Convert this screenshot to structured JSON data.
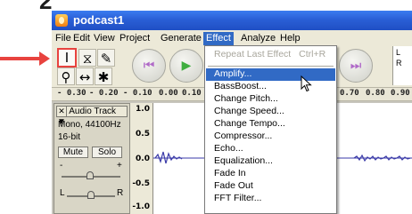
{
  "step_number": "2",
  "window": {
    "title": "podcast1"
  },
  "menubar": {
    "items": [
      "File",
      "Edit",
      "View",
      "Project",
      "Generate",
      "Effect",
      "Analyze",
      "Help"
    ],
    "active": "Effect"
  },
  "tools": {
    "selection_tool": "I",
    "envelope_tool": "⧖",
    "draw_tool": "✎",
    "zoom_tool": "⚲",
    "timeshift_tool": "↔",
    "multi_tool": "✱"
  },
  "transport": {
    "rewind_glyph": "⏮",
    "play_glyph": "▶",
    "forward_glyph": "⏭"
  },
  "meter": {
    "l": "L",
    "r": "R"
  },
  "ruler": {
    "left_ticks": [
      "- 0.30",
      "- 0.20",
      "- 0.10",
      "0.00",
      "0.10"
    ],
    "right_ticks": [
      "0.70",
      "0.80",
      "0.90"
    ]
  },
  "track": {
    "name": "Audio Track",
    "info_rate": "Mono, 44100Hz",
    "info_bits": "16-bit",
    "mute": "Mute",
    "solo": "Solo",
    "gain_minus": "-",
    "gain_plus": "+",
    "pan_left": "L",
    "pan_right": "R",
    "vruler_ticks": [
      "1.0",
      "0.5",
      "0.0",
      "-0.5",
      "-1.0"
    ]
  },
  "effect_menu": {
    "repeat_label": "Repeat Last Effect",
    "repeat_shortcut": "Ctrl+R",
    "items": [
      "Amplify...",
      "BassBoost...",
      "Change Pitch...",
      "Change Speed...",
      "Change Tempo...",
      "Compressor...",
      "Echo...",
      "Equalization...",
      "Fade In",
      "Fade Out",
      "FFT Filter..."
    ],
    "highlighted": "Amplify..."
  },
  "colors": {
    "annotation_red": "#e8433f",
    "titlebar_blue": "#2a5fd6",
    "menu_highlight": "#316ac5",
    "waveform": "#3a3aa8"
  }
}
